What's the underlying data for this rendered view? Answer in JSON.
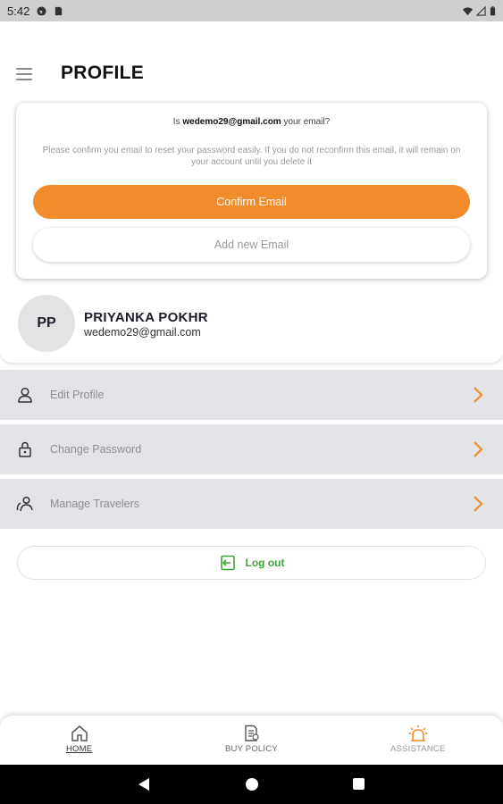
{
  "status_bar": {
    "time": "5:42",
    "icons_left": [
      "gmail-icon",
      "sim-icon"
    ],
    "icons_right": [
      "wifi-icon",
      "signal-icon",
      "battery-icon"
    ]
  },
  "header": {
    "title": "PROFILE",
    "menu_icon": "hamburger-menu-icon"
  },
  "email_confirm": {
    "question_prefix": "Is",
    "email": "wedemo29@gmail.com",
    "question_suffix": "your email?",
    "description": "Please confirm you email to reset your password easily. If you do not reconfirm this email, it will remain on your account until you delete it",
    "confirm_label": "Confirm Email",
    "add_label": "Add new Email",
    "accent_color": "#f28c2b"
  },
  "profile": {
    "initials": "PP",
    "name": "PRIYANKA POKHR",
    "email": "wedemo29@gmail.com"
  },
  "menu": [
    {
      "label": "Edit Profile",
      "icon": "user-icon"
    },
    {
      "label": "Change Password",
      "icon": "lock-icon"
    },
    {
      "label": "Manage Travelers",
      "icon": "users-icon"
    }
  ],
  "logout": {
    "label": "Log out",
    "color": "#3fa535"
  },
  "bottom_nav": {
    "items": [
      {
        "label": "HOME",
        "icon": "home-icon"
      },
      {
        "label": "BUY POLICY",
        "icon": "policy-icon"
      },
      {
        "label": "ASSISTANCE",
        "icon": "alarm-icon"
      }
    ]
  }
}
